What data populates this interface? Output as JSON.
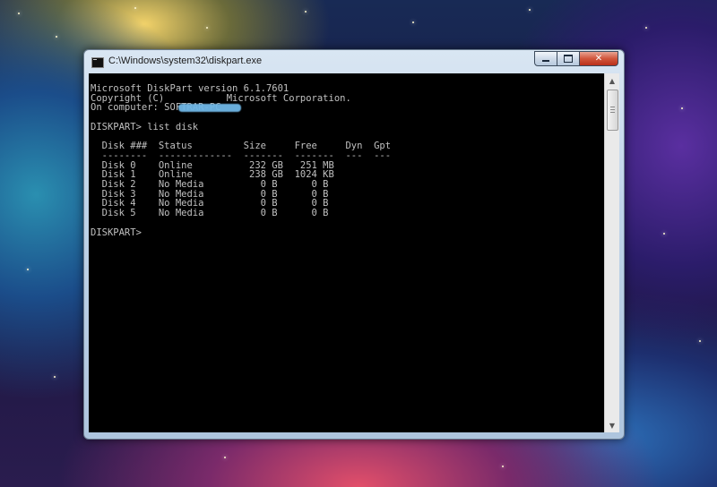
{
  "window": {
    "title": "C:\\Windows\\system32\\diskpart.exe",
    "controls": {
      "minimize": "",
      "maximize": "",
      "close": "✕"
    }
  },
  "console": {
    "text": "Microsoft DiskPart version 6.1.7601\nCopyright (C)           Microsoft Corporation.\nOn computer: SOFTRAR-PC\n\nDISKPART> list disk\n\n  Disk ###  Status         Size     Free     Dyn  Gpt\n  --------  -------------  -------  -------  ---  ---\n  Disk 0    Online          232 GB   251 MB\n  Disk 1    Online          238 GB  1024 KB\n  Disk 2    No Media          0 B      0 B\n  Disk 3    No Media          0 B      0 B\n  Disk 4    No Media          0 B      0 B\n  Disk 5    No Media          0 B      0 B\n\nDISKPART> "
  },
  "colors": {
    "console_bg": "#000000",
    "console_fg": "#c0c0c0",
    "titlebar": "#bfd3e8",
    "close_button": "#c8452c"
  },
  "icons": {
    "app": "console-app-icon",
    "scroll_up": "scroll-up-arrow-icon",
    "scroll_down": "scroll-down-arrow-icon"
  }
}
